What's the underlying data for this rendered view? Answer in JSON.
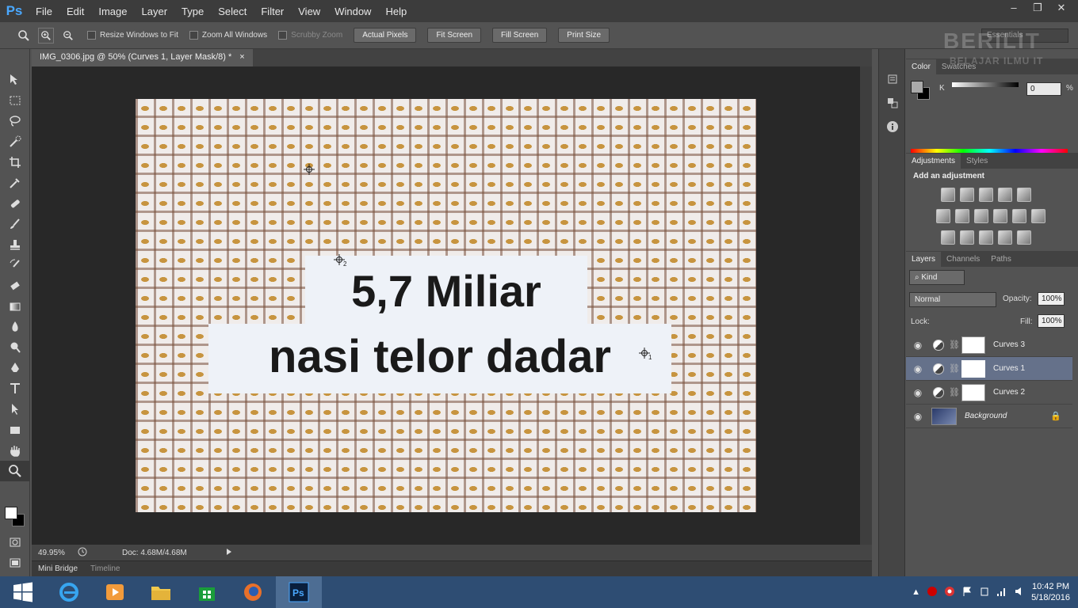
{
  "app": {
    "logo": "Ps",
    "menu": [
      "File",
      "Edit",
      "Image",
      "Layer",
      "Type",
      "Select",
      "Filter",
      "View",
      "Window",
      "Help"
    ],
    "window_controls": [
      "–",
      "❐",
      "✕"
    ]
  },
  "options_bar": {
    "resize_windows": "Resize Windows to Fit",
    "zoom_all": "Zoom All Windows",
    "scrubby_zoom": "Scrubby Zoom",
    "buttons": [
      "Actual Pixels",
      "Fit Screen",
      "Fill Screen",
      "Print Size"
    ],
    "workspace": "Essentials"
  },
  "document": {
    "tab_title": "IMG_0306.jpg @ 50% (Curves 1, Layer Mask/8) *",
    "tab_close": "×",
    "image_text_line1": "5,7 Miliar",
    "image_text_line2": "nasi telor dadar",
    "sampler_2": "2",
    "sampler_1": "1"
  },
  "status": {
    "zoom": "49.95%",
    "doc_size": "Doc: 4.68M/4.68M"
  },
  "bottom_tabs": [
    "Mini Bridge",
    "Timeline"
  ],
  "color_panel": {
    "tabs": [
      "Color",
      "Swatches"
    ],
    "channel": "K",
    "value": "0",
    "unit": "%"
  },
  "adjustments_panel": {
    "tabs": [
      "Adjustments",
      "Styles"
    ],
    "heading": "Add an adjustment"
  },
  "layers_panel": {
    "tabs": [
      "Layers",
      "Channels",
      "Paths"
    ],
    "filter_kind": "Kind",
    "blend_mode": "Normal",
    "opacity_label": "Opacity:",
    "opacity": "100%",
    "lock_label": "Lock:",
    "fill_label": "Fill:",
    "fill": "100%",
    "layers": [
      {
        "name": "Curves 3",
        "selected": false
      },
      {
        "name": "Curves 1",
        "selected": true
      },
      {
        "name": "Curves 2",
        "selected": false
      },
      {
        "name": "Background",
        "selected": false
      }
    ]
  },
  "watermark": {
    "line1": "BERILIT",
    "line2": "BELAJAR ILMU IT"
  },
  "taskbar": {
    "time": "10:42 PM",
    "date": "5/18/2016"
  }
}
